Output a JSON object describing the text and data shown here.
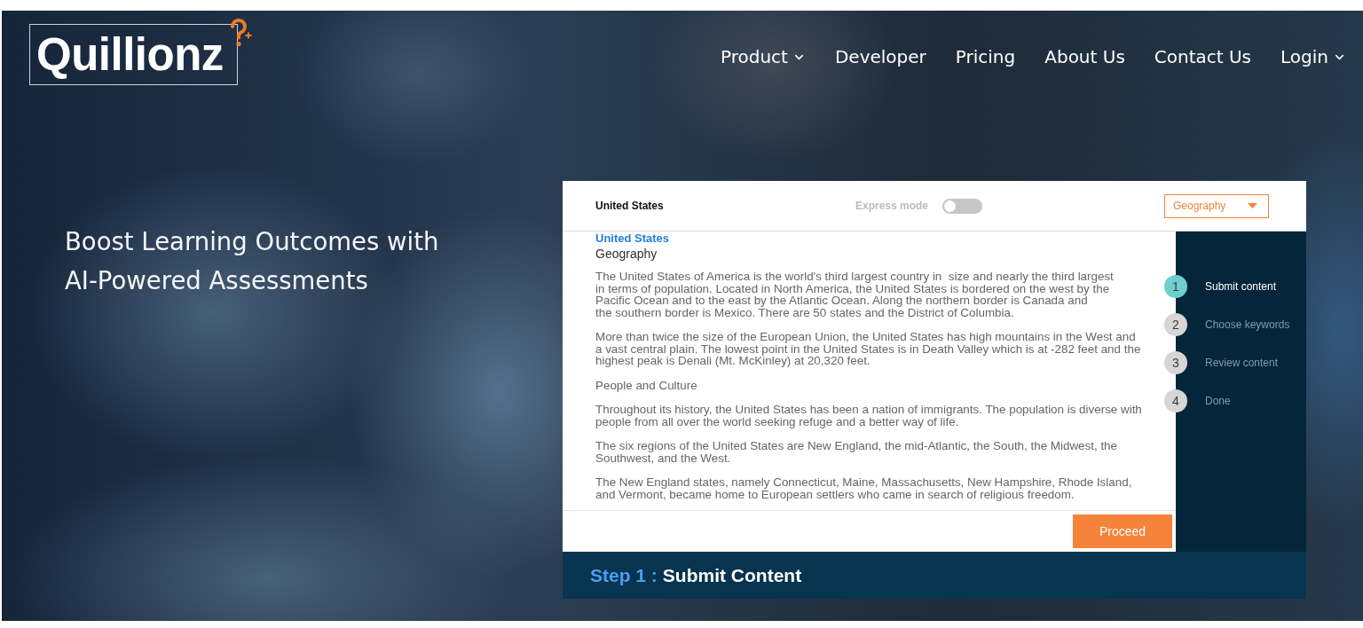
{
  "logo": {
    "text": "Quillionz"
  },
  "nav": [
    {
      "label": "Product",
      "kind": "dropdown"
    },
    {
      "label": "Developer",
      "kind": "link"
    },
    {
      "label": "Pricing",
      "kind": "link"
    },
    {
      "label": "About Us",
      "kind": "link"
    },
    {
      "label": "Contact Us",
      "kind": "link"
    },
    {
      "label": "Login",
      "kind": "dropdown"
    }
  ],
  "hero": {
    "headline": "Boost Learning Outcomes with AI-Powered Assessments"
  },
  "demo": {
    "header": {
      "title": "United States",
      "express_mode": {
        "label": "Express mode",
        "on": false
      },
      "subject_select": {
        "value": "Geography"
      }
    },
    "content": [
      {
        "kind": "title",
        "text": "United States"
      },
      {
        "kind": "subtitle",
        "text": "Geography"
      },
      {
        "kind": "paragraph",
        "text": "The United States of America is the world's third largest country in  size and nearly the third largest\nin terms of population. Located in North America, the United States is bordered on the west by the\nPacific Ocean and to the east by the Atlantic Ocean. Along the northern border is Canada and\nthe southern border is Mexico. There are 50 states and the District of Columbia."
      },
      {
        "kind": "paragraph",
        "text": "More than twice the size of the European Union, the United States has high mountains in the West and\na vast central plain. The lowest point in the United States is in Death Valley which is at -282 feet and the\nhighest peak is Denali (Mt. McKinley) at 20,320 feet."
      },
      {
        "kind": "paragraph",
        "text": "People and Culture"
      },
      {
        "kind": "paragraph",
        "text": "Throughout its history, the United States has been a nation of immigrants. The population is diverse with\npeople from all over the world seeking refuge and a better way of life."
      },
      {
        "kind": "paragraph",
        "text": "The six regions of the United States are New England, the mid-Atlantic, the South, the Midwest, the\nSouthwest, and the West."
      },
      {
        "kind": "paragraph",
        "text": "The New England states, namely Connecticut, Maine, Massachusetts, New Hampshire, Rhode Island,\nand Vermont, became home to European settlers who came in search of religious freedom."
      }
    ],
    "proceed_button": "Proceed",
    "steps": [
      {
        "number": "1",
        "label": "Submit content",
        "selected": true
      },
      {
        "number": "2",
        "label": "Choose keywords",
        "selected": false
      },
      {
        "number": "3",
        "label": "Review content",
        "selected": false
      },
      {
        "number": "4",
        "label": "Done",
        "selected": false
      }
    ],
    "step_banner": {
      "prefix": "Step 1 :",
      "title": "Submit Content"
    }
  }
}
